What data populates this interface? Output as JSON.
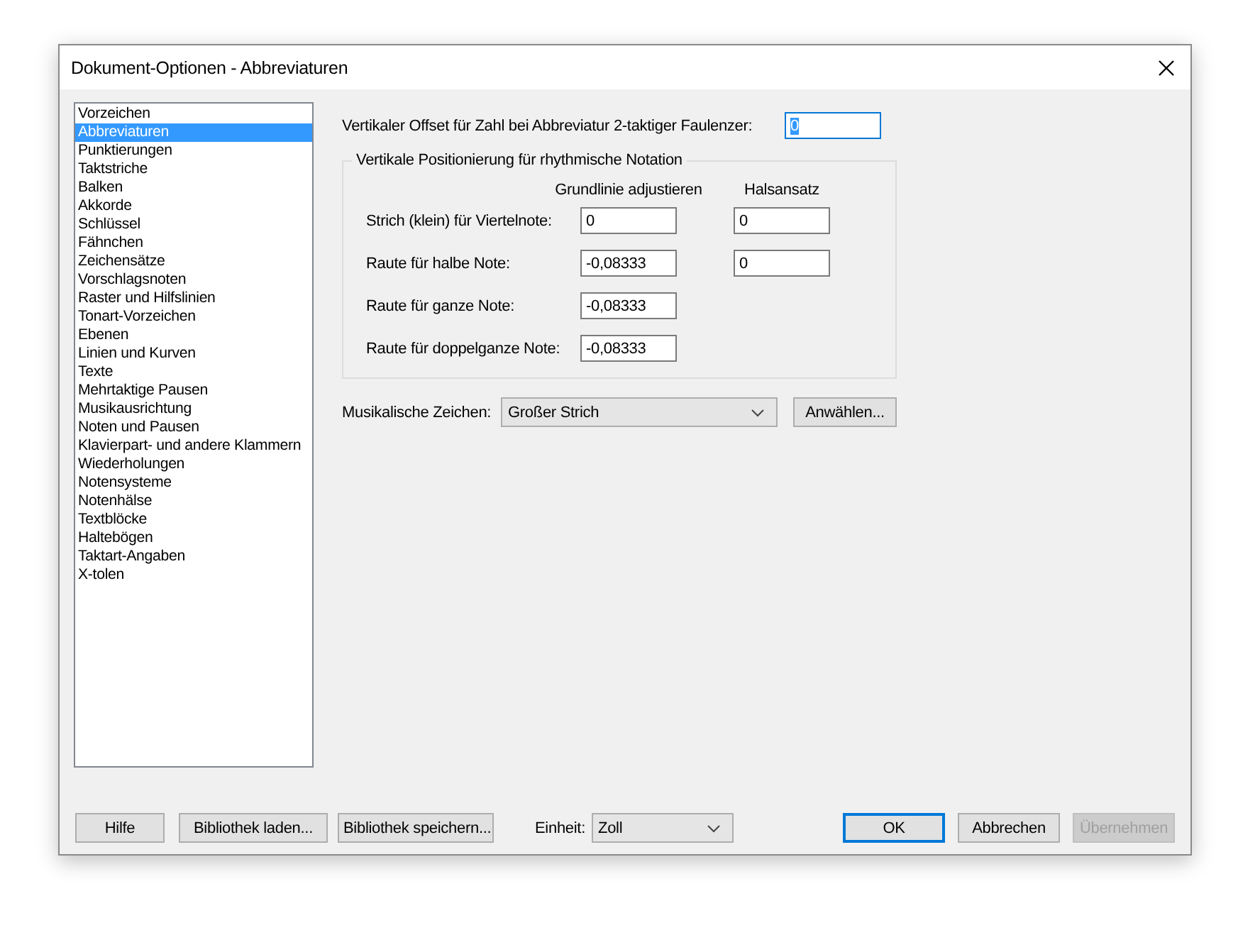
{
  "window": {
    "title": "Dokument-Optionen - Abbreviaturen"
  },
  "categories": [
    {
      "label": "Vorzeichen",
      "selected": false
    },
    {
      "label": "Abbreviaturen",
      "selected": true
    },
    {
      "label": "Punktierungen",
      "selected": false
    },
    {
      "label": "Taktstriche",
      "selected": false
    },
    {
      "label": "Balken",
      "selected": false
    },
    {
      "label": "Akkorde",
      "selected": false
    },
    {
      "label": "Schlüssel",
      "selected": false
    },
    {
      "label": "Fähnchen",
      "selected": false
    },
    {
      "label": "Zeichensätze",
      "selected": false
    },
    {
      "label": "Vorschlagsnoten",
      "selected": false
    },
    {
      "label": "Raster und Hilfslinien",
      "selected": false
    },
    {
      "label": "Tonart-Vorzeichen",
      "selected": false
    },
    {
      "label": "Ebenen",
      "selected": false
    },
    {
      "label": "Linien und Kurven",
      "selected": false
    },
    {
      "label": "Texte",
      "selected": false
    },
    {
      "label": "Mehrtaktige Pausen",
      "selected": false
    },
    {
      "label": "Musikausrichtung",
      "selected": false
    },
    {
      "label": "Noten und Pausen",
      "selected": false
    },
    {
      "label": "Klavierpart- und andere Klammern",
      "selected": false
    },
    {
      "label": "Wiederholungen",
      "selected": false
    },
    {
      "label": "Notensysteme",
      "selected": false
    },
    {
      "label": "Notenhälse",
      "selected": false
    },
    {
      "label": "Textblöcke",
      "selected": false
    },
    {
      "label": "Haltebögen",
      "selected": false
    },
    {
      "label": "Taktart-Angaben",
      "selected": false
    },
    {
      "label": "X-tolen",
      "selected": false
    }
  ],
  "offset": {
    "label": "Vertikaler Offset für Zahl bei Abbreviatur 2-taktiger Faulenzer:",
    "value": "0",
    "focused": true
  },
  "group": {
    "title": "Vertikale Positionierung für rhythmische Notation",
    "columns": [
      "Grundlinie adjustieren",
      "Halsansatz"
    ],
    "rows": [
      {
        "label": "Strich (klein) für Viertelnote:",
        "values": [
          "0",
          "0"
        ]
      },
      {
        "label": "Raute für halbe Note:",
        "values": [
          "-0,08333",
          "0"
        ]
      },
      {
        "label": "Raute für ganze Note:",
        "values": [
          "-0,08333"
        ]
      },
      {
        "label": "Raute für doppelganze Note:",
        "values": [
          "-0,08333"
        ]
      }
    ]
  },
  "symbol": {
    "label": "Musikalische Zeichen:",
    "value": "Großer Strich",
    "button": "Anwählen..."
  },
  "footer": {
    "buttons": [
      "Hilfe",
      "Bibliothek laden...",
      "Bibliothek speichern..."
    ],
    "unit": {
      "label": "Einheit:",
      "value": "Zoll"
    },
    "actions": [
      {
        "label": "OK",
        "default": true,
        "disabled": false
      },
      {
        "label": "Abbrechen",
        "default": false,
        "disabled": false
      },
      {
        "label": "Übernehmen",
        "default": false,
        "disabled": true
      }
    ]
  }
}
